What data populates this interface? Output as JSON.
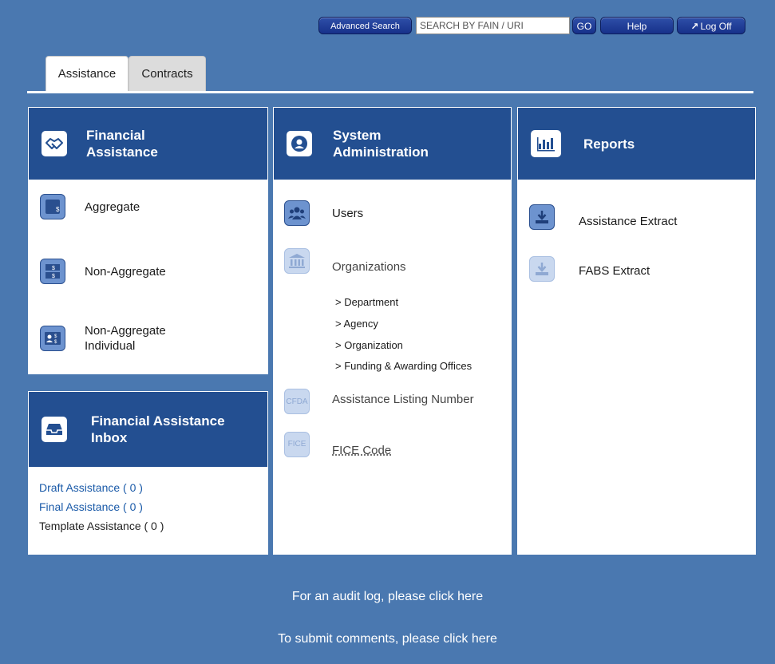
{
  "toolbar": {
    "advanced_search": "Advanced Search",
    "search_placeholder": "SEARCH BY FAIN / URI",
    "go": "GO",
    "help": "Help",
    "log_off": "Log Off"
  },
  "tabs": [
    {
      "label": "Assistance",
      "active": true
    },
    {
      "label": "Contracts",
      "active": false
    }
  ],
  "financial_assistance": {
    "title_line1": "Financial",
    "title_line2": "Assistance",
    "items": [
      {
        "label": "Aggregate"
      },
      {
        "label": "Non-Aggregate"
      },
      {
        "label_line1": "Non-Aggregate",
        "label_line2": "Individual"
      }
    ]
  },
  "inbox": {
    "title_line1": "Financial Assistance",
    "title_line2": "Inbox",
    "draft": "Draft Assistance ( 0 )",
    "final": "Final Assistance ( 0 )",
    "template": "Template Assistance ( 0 )"
  },
  "system_admin": {
    "title_line1": "System",
    "title_line2": "Administration",
    "users": "Users",
    "organizations": "Organizations",
    "sub_items": [
      "> Department",
      "> Agency",
      "> Organization",
      "> Funding & Awarding Offices"
    ],
    "cfda_icon_text": "CFDA",
    "assistance_listing": "Assistance Listing Number",
    "fice_icon_text": "FICE",
    "fice_code": "FICE Code"
  },
  "reports": {
    "title": "Reports",
    "assistance_extract": "Assistance Extract",
    "fabs_extract": "FABS Extract"
  },
  "footer": {
    "audit_log": "For an audit log, please click here",
    "comments": "To submit comments, please click here"
  },
  "colors": {
    "page_background": "#4a78b0",
    "panel_header": "#234f91",
    "icon_tile": "#6d93cf",
    "link": "#1a5aa8"
  }
}
